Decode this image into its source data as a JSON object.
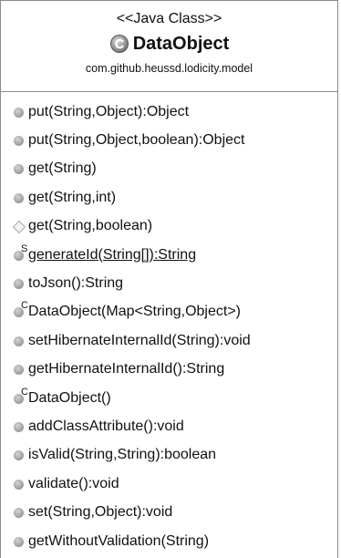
{
  "diagram": {
    "stereotype": "<<Java Class>>",
    "class_name": "DataObject",
    "package": "com.github.heussd.lodicity.model",
    "members": [
      {
        "text": "put(String,Object):Object",
        "visibility": "public"
      },
      {
        "text": "put(String,Object,boolean):Object",
        "visibility": "public"
      },
      {
        "text": "get(String)",
        "visibility": "public"
      },
      {
        "text": "get(String,int)",
        "visibility": "public"
      },
      {
        "text": "get(String,boolean)",
        "visibility": "package"
      },
      {
        "text": "generateId(String[]):String",
        "visibility": "public",
        "modifier": "S",
        "underline": true
      },
      {
        "text": "toJson():String",
        "visibility": "public"
      },
      {
        "text": "DataObject(Map<String,Object>)",
        "visibility": "public",
        "modifier": "C"
      },
      {
        "text": "setHibernateInternalId(String):void",
        "visibility": "public"
      },
      {
        "text": "getHibernateInternalId():String",
        "visibility": "public"
      },
      {
        "text": "DataObject()",
        "visibility": "public",
        "modifier": "C"
      },
      {
        "text": "addClassAttribute():void",
        "visibility": "public"
      },
      {
        "text": "isValid(String,String):boolean",
        "visibility": "public"
      },
      {
        "text": "validate():void",
        "visibility": "public"
      },
      {
        "text": "set(String,Object):void",
        "visibility": "public"
      },
      {
        "text": "getWithoutValidation(String)",
        "visibility": "public"
      }
    ]
  }
}
